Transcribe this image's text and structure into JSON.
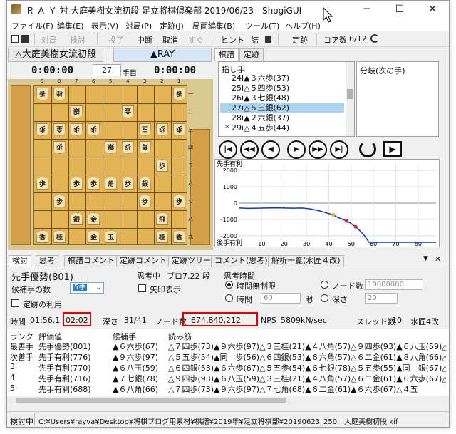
{
  "window": {
    "title": "Ｒ Ａ Ｙ 対 大庭美樹女流初段 足立将棋倶楽部 2019/06/23 - ShogiGUI",
    "buttons": {
      "minimize": "─",
      "maximize": "☐",
      "close": "✕"
    }
  },
  "menu": [
    "ファイル(F)",
    "編集(E)",
    "表示(V)",
    "対局(P)",
    "定跡(J)",
    "局面編集(B)",
    "ツール(T)",
    "ヘルプ(H)"
  ],
  "toolbar": {
    "taikyoku": "対局",
    "kento": "検討",
    "toryo": "投了",
    "chudan": "中断",
    "torikeshi": "取消",
    "sugu": "すぐ",
    "hint": "ヒント",
    "tsume": "詰",
    "stop_icon": "stop-icon",
    "joseki": "定跡",
    "core": "コア数",
    "core_value": "6/12"
  },
  "players": {
    "gote_name": "△大庭美樹女流初段",
    "sente_name": "▲RAY",
    "gote_time": "0:00:00",
    "sente_time": "0:00:00",
    "move_number": "27",
    "move_suffix": "手目"
  },
  "board": {
    "files": [
      "9",
      "8",
      "7",
      "6",
      "5",
      "4",
      "3",
      "2",
      "1"
    ],
    "ranks": [
      "一",
      "二",
      "三",
      "四",
      "五",
      "六",
      "七",
      "八",
      "九"
    ]
  },
  "kifu": {
    "tabs": [
      "棋譜",
      "定跡"
    ],
    "header": "指し手",
    "rows": [
      {
        "no": "24",
        "mark": "i",
        "move": "▲３六歩(37)",
        "selected": false
      },
      {
        "no": "25",
        "mark": "i",
        "move": "△５四歩(53)",
        "selected": false
      },
      {
        "no": "26",
        "mark": "i",
        "move": "▲３七銀(48)",
        "selected": false
      },
      {
        "no": "27",
        "mark": "i",
        "move": "△５三銀(62)",
        "selected": true
      },
      {
        "no": "28",
        "mark": "i",
        "move": "▲２六銀(37)",
        "selected": false
      },
      {
        "no": "* 29",
        "mark": "i",
        "move": "△４五歩(44)",
        "selected": false
      }
    ],
    "branch_header": "分岐(次の手)"
  },
  "graph": {
    "top_label": "先手有利",
    "bottom_label": "後手有利",
    "y_ticks": [
      "2000",
      "1000",
      "0",
      "-1000",
      "-2000"
    ],
    "x_ticks": [
      "10",
      "20",
      "30",
      "40",
      "50",
      "60",
      "70",
      "80"
    ]
  },
  "chart_data": {
    "type": "line",
    "xlabel": "",
    "ylabel": "",
    "ylim": [
      -2400,
      2400
    ],
    "xlim": [
      0,
      88
    ],
    "series": [
      {
        "x": [
          0,
          4,
          8,
          12,
          16,
          20,
          24,
          28,
          30,
          32,
          34,
          36,
          38,
          40,
          42,
          44,
          46,
          48,
          50,
          52,
          54,
          56,
          58,
          60,
          62,
          64,
          66,
          68,
          70,
          72,
          74,
          76,
          78,
          80,
          82,
          84,
          86,
          88
        ],
        "y": [
          -300,
          -320,
          -310,
          -300,
          -290,
          -300,
          -310,
          -300,
          -330,
          -360,
          -420,
          -480,
          -560,
          -640,
          -720,
          -880,
          -980,
          -1100,
          -1250,
          -1450,
          -1700,
          -2000,
          -2400,
          -2400,
          -2400,
          -2400,
          -2400,
          -2400,
          -2400,
          -2400,
          -2400,
          -2400,
          -2400,
          -2400,
          -2400,
          -2400,
          -2400,
          -2400
        ]
      }
    ],
    "markers": [
      {
        "x": 42,
        "y": -720,
        "color": "#f0a020"
      },
      {
        "x": 48,
        "y": -1100,
        "color": "#e02020"
      },
      {
        "x": 52,
        "y": -1450,
        "color": "#e02020"
      }
    ]
  },
  "analysis": {
    "tabs": [
      "検討",
      "思考",
      "棋譜コメント",
      "定跡コメント",
      "定跡ツリー",
      "コメント(思考)",
      "解析一覧(水匠４改)"
    ],
    "eval_text": "先手優勢(801)",
    "thinking_label": "思考中",
    "engine_name": "ブロ7.22 段",
    "think_time_label": "思考時間",
    "candidates_label": "候補手の数",
    "candidates_value": "5手",
    "arrow_label": "矢印表示",
    "joseki_use": "定跡の利用",
    "r_unlimited": "時間無制限",
    "r_time": "時間",
    "time_value": "60",
    "sec": "秒",
    "r_nodes": "ノード数",
    "nodes_value": "10000000",
    "r_depth": "深さ",
    "depth_value": "20",
    "stats": {
      "time_label": "時間",
      "time_value": "01:56.1",
      "limit_value": "02:02",
      "depth_label": "深さ",
      "depth_value": "31/41",
      "node_label": "ノード数",
      "node_value": "674,840,212",
      "nps_label": "NPS",
      "nps_value": "5809kN/sec",
      "threads_label": "スレッド数",
      "threads_value": "10",
      "engine": "水匠4改"
    },
    "pv_headers": [
      "ランク",
      "評価値",
      "候補手",
      "読み筋"
    ],
    "pv_rows": [
      {
        "rank": "最善手",
        "eval": "先手優勢(801)",
        "move": "▲６六歩(67)",
        "line": "△７四歩(73)▲９六歩(97)△３三桂(21)▲４八角(57)△９四歩(93)▲６八玉(59)△４五"
      },
      {
        "rank": "次善手",
        "eval": "先手有利(776)",
        "move": "▲９六歩(97)",
        "line": "△５五歩(54)▲同　歩(56)△６四銀(53)▲６六角(57)△６二金(61)▲８八角(66)△１四"
      },
      {
        "rank": "3",
        "eval": "先手有利(770)",
        "move": "▲６八玉(59)",
        "line": "△６四銀(53)▲６六歩(67)△５五歩(54)▲６七銀(78)△５五歩(55)▲同　銀(67)△４五"
      },
      {
        "rank": "4",
        "eval": "先手有利(716)",
        "move": "▲７七銀(78)",
        "line": "△９四歩(93)▲６八玉(59)△３三桂(21)▲４八角(57)△６二金(61)▲６六歩(67)△４五"
      },
      {
        "rank": "5",
        "eval": "先手有利(688)",
        "move": "▲６八角(66)",
        "line": "△７四歩(73)▲９六歩(97)△７七角(68)▲６二金(61)▲６六歩(67)△４五"
      }
    ]
  },
  "status": {
    "mode": "検討中",
    "path": "C:¥Users¥rayva¥Desktop¥将棋ブログ用素材¥棋譜¥2019年¥足立将棋部¥20190623_250　大庭美樹初段.kif"
  }
}
